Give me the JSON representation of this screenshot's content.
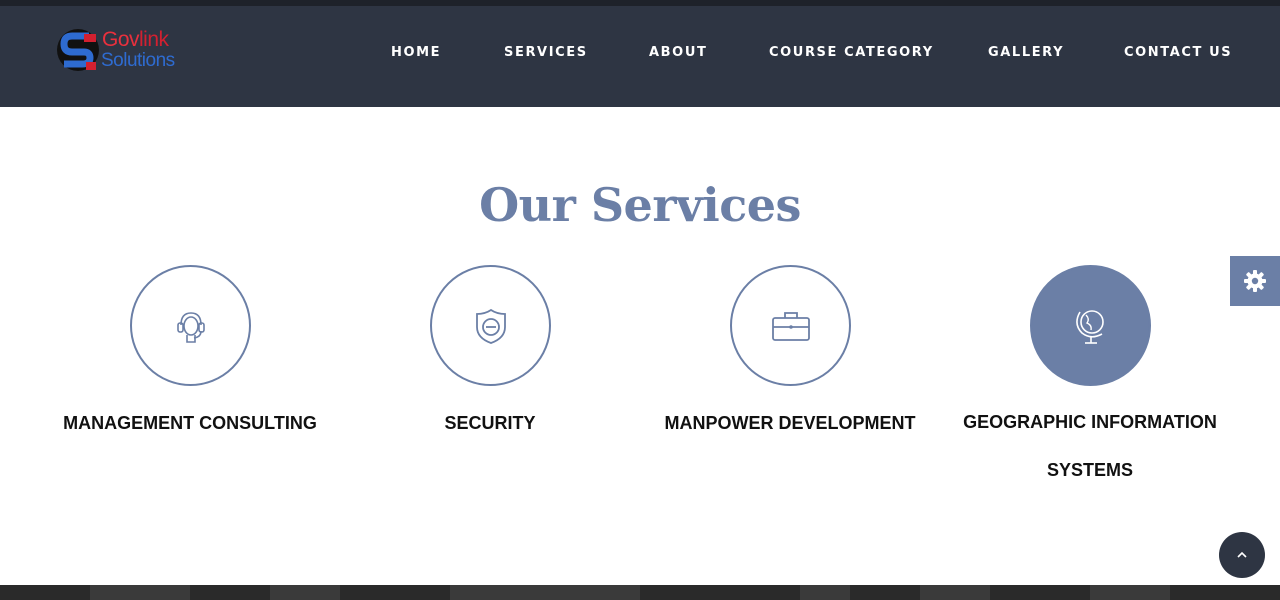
{
  "logo": {
    "gov": "Gov",
    "link": "link",
    "solutions": "Solutions"
  },
  "nav": [
    {
      "label": "HOME"
    },
    {
      "label": "SERVICES"
    },
    {
      "label": "ABOUT"
    },
    {
      "label": "COURSE CATEGORY"
    },
    {
      "label": "GALLERY"
    },
    {
      "label": "CONTACT US"
    }
  ],
  "section": {
    "title": "Our Services"
  },
  "services": [
    {
      "label": "MANAGEMENT CONSULTING",
      "icon": "headset-icon"
    },
    {
      "label": "SECURITY",
      "icon": "shield-icon"
    },
    {
      "label": "MANPOWER DEVELOPMENT",
      "icon": "briefcase-icon"
    },
    {
      "label_line1": "GEOGRAPHIC INFORMATION",
      "label_line2": "SYSTEMS",
      "icon": "globe-icon"
    }
  ],
  "colors": {
    "accent": "#6b7fa6",
    "navbar": "#2e3543",
    "brand_red": "#d32030",
    "brand_blue": "#2e6bd0"
  }
}
